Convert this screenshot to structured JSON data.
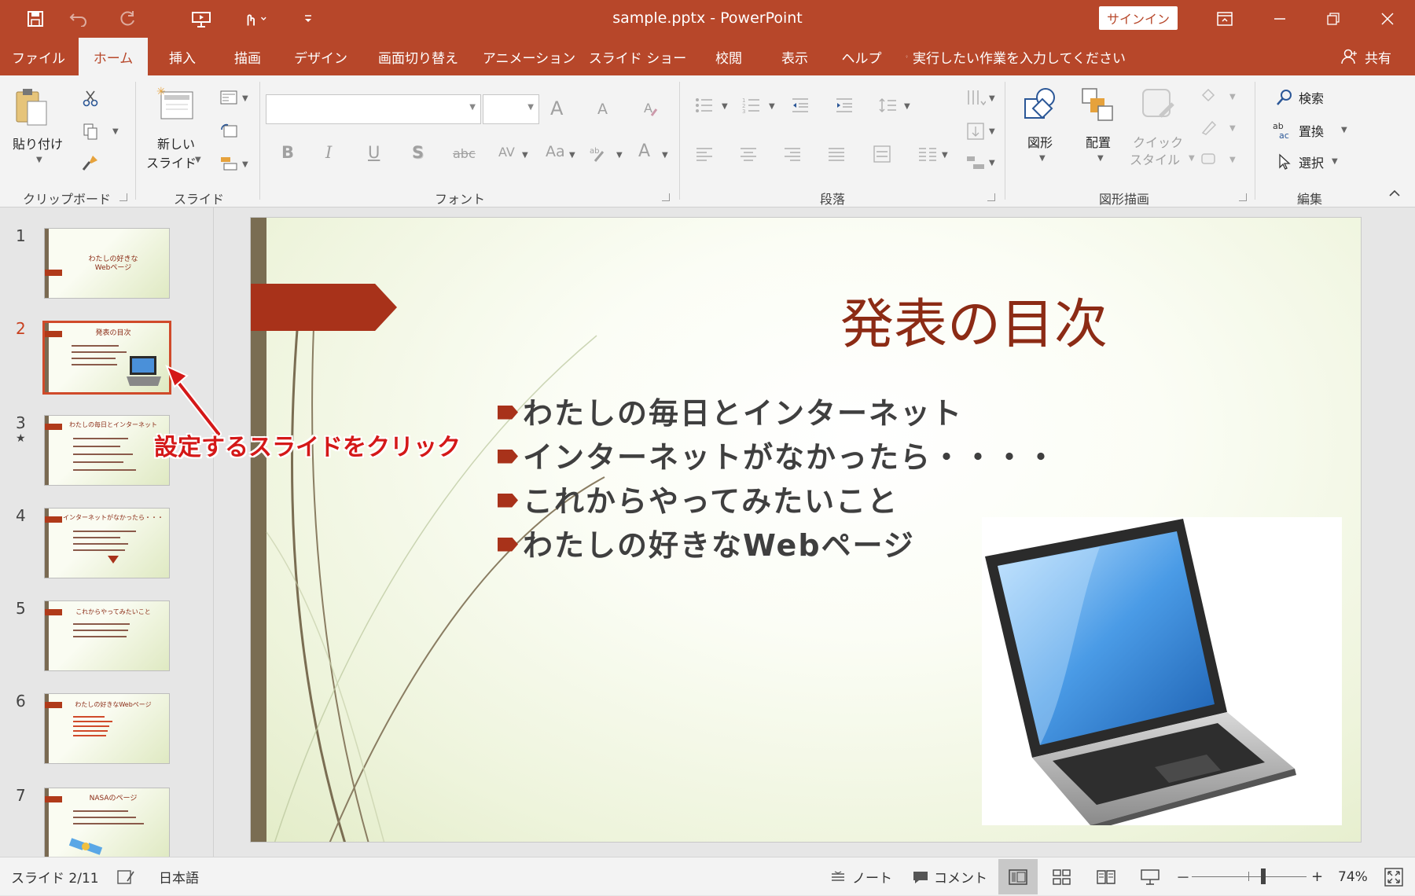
{
  "window": {
    "title": "sample.pptx  -  PowerPoint",
    "signin_label": "サインイン",
    "accent": "#b7472a"
  },
  "quick_access": [
    "save-icon",
    "undo-icon",
    "redo-icon",
    "presenter-icon",
    "touch-mode-icon",
    "customize-icon"
  ],
  "tabs": [
    {
      "label": "ファイル"
    },
    {
      "label": "ホーム",
      "active": true
    },
    {
      "label": "挿入"
    },
    {
      "label": "描画"
    },
    {
      "label": "デザイン"
    },
    {
      "label": "画面切り替え"
    },
    {
      "label": "アニメーション"
    },
    {
      "label": "スライド ショー"
    },
    {
      "label": "校閲"
    },
    {
      "label": "表示"
    },
    {
      "label": "ヘルプ"
    }
  ],
  "tell_me": "実行したい作業を入力してください",
  "share_label": "共有",
  "ribbon": {
    "clipboard": {
      "paste_label": "貼り付け",
      "group_label": "クリップボード"
    },
    "slides": {
      "new_slide_label_1": "新しい",
      "new_slide_label_2": "スライド",
      "group_label": "スライド"
    },
    "font": {
      "group_label": "フォント",
      "bold": "B",
      "italic": "I",
      "underline": "U",
      "shadow": "S",
      "strike": "abc",
      "spacing": "AV",
      "case": "Aa",
      "grow": "A",
      "shrink": "A",
      "color": "A"
    },
    "paragraph": {
      "group_label": "段落"
    },
    "drawing": {
      "shapes_label": "図形",
      "arrange_label": "配置",
      "quick_style_label_1": "クイック",
      "quick_style_label_2": "スタイル",
      "group_label": "図形描画"
    },
    "editing": {
      "find_label": "検索",
      "replace_label": "置換",
      "select_label": "選択",
      "group_label": "編集"
    }
  },
  "thumbnails": [
    {
      "num": "1",
      "title": "わたしの好きな\nWebページ",
      "selected": false
    },
    {
      "num": "2",
      "title": "発表の目次",
      "selected": true
    },
    {
      "num": "3",
      "title": "わたしの毎日とインターネット",
      "selected": false,
      "star": "★"
    },
    {
      "num": "4",
      "title": "インターネットがなかったら・・・",
      "selected": false
    },
    {
      "num": "5",
      "title": "これからやってみたいこと",
      "selected": false
    },
    {
      "num": "6",
      "title": "わたしの好きなWebページ",
      "selected": false
    },
    {
      "num": "7",
      "title": "NASAのページ",
      "selected": false
    }
  ],
  "slide": {
    "title": "発表の目次",
    "bullets": [
      "わたしの毎日とインターネット",
      "インターネットがなかったら・・・・",
      "これからやってみたいこと",
      "わたしの好きなWebページ"
    ]
  },
  "annotation": "設定するスライドをクリック",
  "status": {
    "slide_counter": "スライド 2/11",
    "language": "日本語",
    "notes_label": "ノート",
    "comments_label": "コメント",
    "zoom_minus": "－",
    "zoom_plus": "+",
    "zoom_level": "74%",
    "zoom_fraction": 0.62
  }
}
